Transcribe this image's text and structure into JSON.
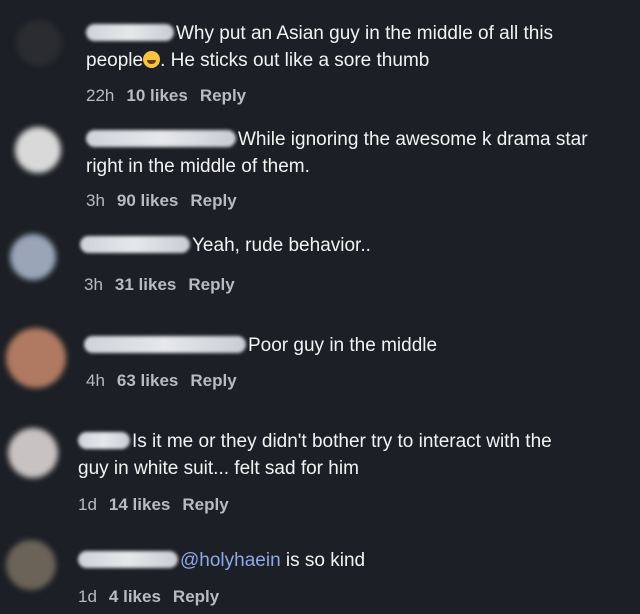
{
  "comments": [
    {
      "text_a": "Why put an Asian guy in the middle of all this",
      "text_b": "people",
      "text_c": ". He sticks out like a sore thumb",
      "time": "22h",
      "likes": "10 likes",
      "reply": "Reply",
      "avatar_color": "#2a2c30",
      "emoji": "crying-laughing-emoji"
    },
    {
      "text_a": "While ignoring the awesome k drama star",
      "text_b": "right in the middle of them.",
      "time": "3h",
      "likes": "90 likes",
      "reply": "Reply",
      "avatar_color": "#d9d9d9"
    },
    {
      "text_a": "Yeah, rude behavior..",
      "time": "3h",
      "likes": "31 likes",
      "reply": "Reply",
      "avatar_color": "#9aa6b8"
    },
    {
      "text_a": "Poor guy in the middle",
      "time": "4h",
      "likes": "63 likes",
      "reply": "Reply",
      "avatar_color": "#b07a62"
    },
    {
      "text_a": "Is it me or they didn't bother try to interact with the",
      "text_b": "guy in white suit... felt sad for him",
      "time": "1d",
      "likes": "14 likes",
      "reply": "Reply",
      "avatar_color": "#c9c2c2"
    },
    {
      "mention": "@holyhaein",
      "text_a": " is so kind",
      "time": "1d",
      "likes": "4 likes",
      "reply": "Reply",
      "avatar_color": "#6b6358"
    }
  ]
}
